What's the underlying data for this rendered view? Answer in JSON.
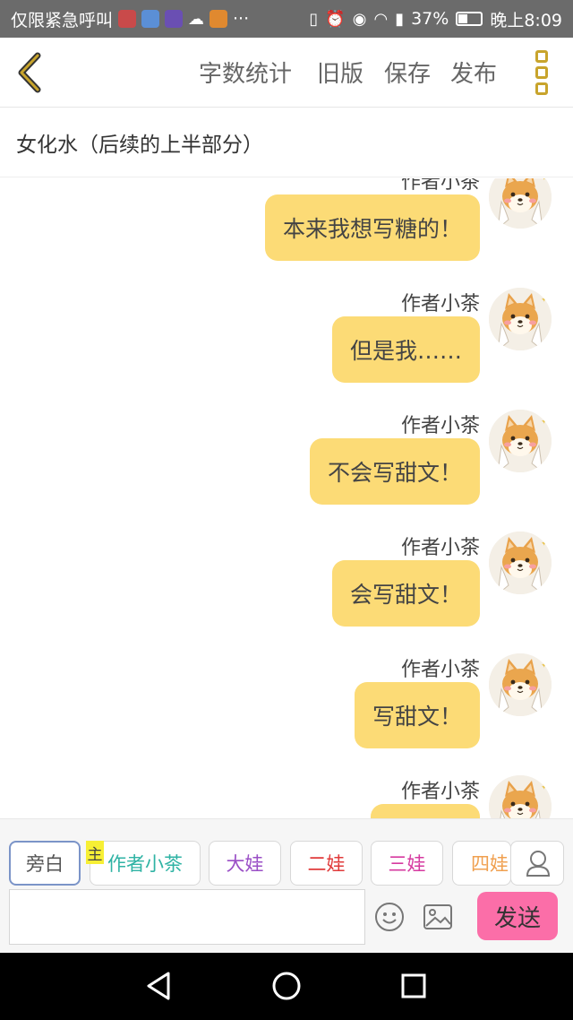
{
  "status_bar": {
    "carrier": "仅限紧急呼叫",
    "more": "···",
    "battery": "37%",
    "time": "晚上8:09"
  },
  "header": {
    "back_icon": "chevron-left-icon",
    "word_count": "字数统计",
    "old_version": "旧版",
    "save": "保存",
    "publish": "发布",
    "more_icon": "more-vertical-icon"
  },
  "document": {
    "title": "女化水（后续的上半部分）"
  },
  "messages": [
    {
      "author": "作者小茶",
      "text": "本来我想写糖的！"
    },
    {
      "author": "作者小茶",
      "text": "但是我……"
    },
    {
      "author": "作者小茶",
      "text": "不会写甜文！"
    },
    {
      "author": "作者小茶",
      "text": "会写甜文！"
    },
    {
      "author": "作者小茶",
      "text": "写甜文！"
    },
    {
      "author": "作者小茶",
      "text": ""
    }
  ],
  "composer": {
    "main_badge": "主",
    "roles": [
      {
        "label": "旁白",
        "color": "#555555"
      },
      {
        "label": "作者小茶",
        "color": "#2fb3a4"
      },
      {
        "label": "大娃",
        "color": "#9a4fc6"
      },
      {
        "label": "二娃",
        "color": "#e03a3a"
      },
      {
        "label": "三娃",
        "color": "#d63aa0"
      },
      {
        "label": "四娃",
        "color": "#f0a050"
      }
    ],
    "input_value": "",
    "input_placeholder": "",
    "send": "发送",
    "icons": [
      "user-icon",
      "emoji-icon",
      "image-icon"
    ]
  },
  "nav_bar": {
    "icons": [
      "back-triangle-icon",
      "home-circle-icon",
      "recents-square-icon"
    ]
  },
  "colors": {
    "bubble": "#fcdb76",
    "send": "#fb6ea8",
    "accent": "#c8a42c"
  }
}
